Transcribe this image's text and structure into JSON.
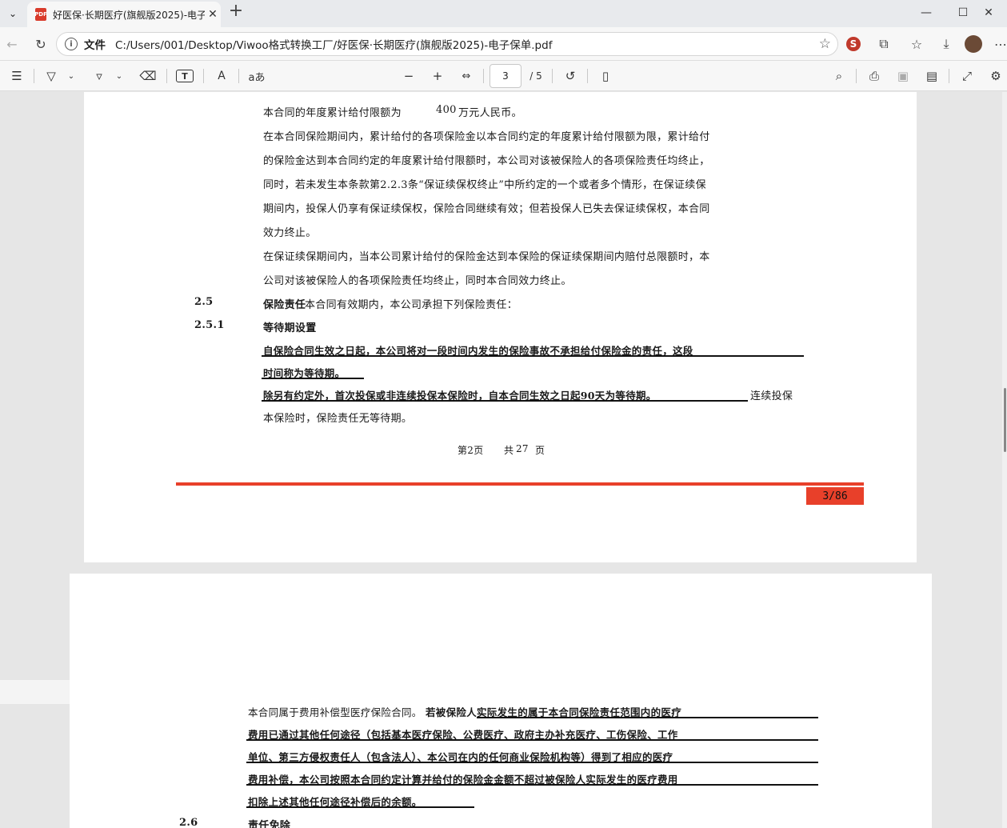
{
  "browser": {
    "tab_title": "好医保·长期医疗(旗舰版2025)-电子保单.pdf",
    "tab_icon": "PDF",
    "address_label": "文件",
    "address_url": "C:/Users/001/Desktop/Viwoo格式转换工厂/好医保·长期医疗(旗舰版2025)-电子保单.pdf"
  },
  "pdf_toolbar": {
    "current_page": "3",
    "total_pages": "/ 5"
  },
  "page1": {
    "lines": [
      "本合同的年度累计给付限额为",
      "400",
      "万元人民币。",
      "在本合同保险期间内，累计给付的各项保险金以本合同约定的年度累计给付限额为限，累计给付",
      "的保险金达到本合同约定的年度累计给付限额时，本公司对该被保险人的各项保险责任均终止，",
      "同时，若未发生本条款第2.2.3条“保证续保权终止”中所约定的一个或者多个情形，在保证续保",
      "期间内，投保人仍享有保证续保权，保险合同继续有效；但若投保人已失去保证续保权，本合同",
      "效力终止。",
      "在保证续保期间内，当本公司累计给付的保险金达到本保险的保证续保期间内赔付总限额时，本",
      "公司对该被保险人的各项保险责任均终止，同时本合同效力终止。"
    ],
    "sec_2_5_num": "2.5",
    "sec_2_5_title": "保险责任",
    "sec_2_5_text": "本合同有效期内，本公司承担下列保险责任：",
    "sec_2_5_1_num": "2.5.1",
    "sec_2_5_1_title": "等待期设置",
    "wait_lines": [
      "自保险合同生效之日起，本公司将对一段时间内发生的保险事故不承担给付保险金的责任，这段",
      "时间称为等待期。",
      "除另有约定外，首次投保或非连续投保本保险时，自本合同生效之日起90天为等待期。",
      "连续投保",
      "本保险时，保险责任无等待期。"
    ],
    "footer_page": "第2页",
    "footer_total_a": "共",
    "footer_total_n": "27",
    "footer_total_b": "页",
    "page_badge": "3/86",
    "accent_color": "#e8402a"
  },
  "page2": {
    "lines": [
      "本合同属于费用补偿型医疗保险合同。",
      "若被保险人实际发生的属于本合同保险责任范围内的医疗",
      "费用已通过其他任何途径（包括基本医疗保险、公费医疗、政府主办补充医疗、工伤保险、工作",
      "单位、第三方侵权责任人（包含法人）、本公司在内的任何商业保险机构等）得到了相应的医疗",
      "费用补偿，本公司按照本合同约定计算并给付的保险金金额不超过被保险人实际发生的医疗费用",
      "扣除上述其他任何途径补偿后的余额。"
    ],
    "sec_2_6_num": "2.6",
    "sec_2_6_title": "责任免除"
  }
}
